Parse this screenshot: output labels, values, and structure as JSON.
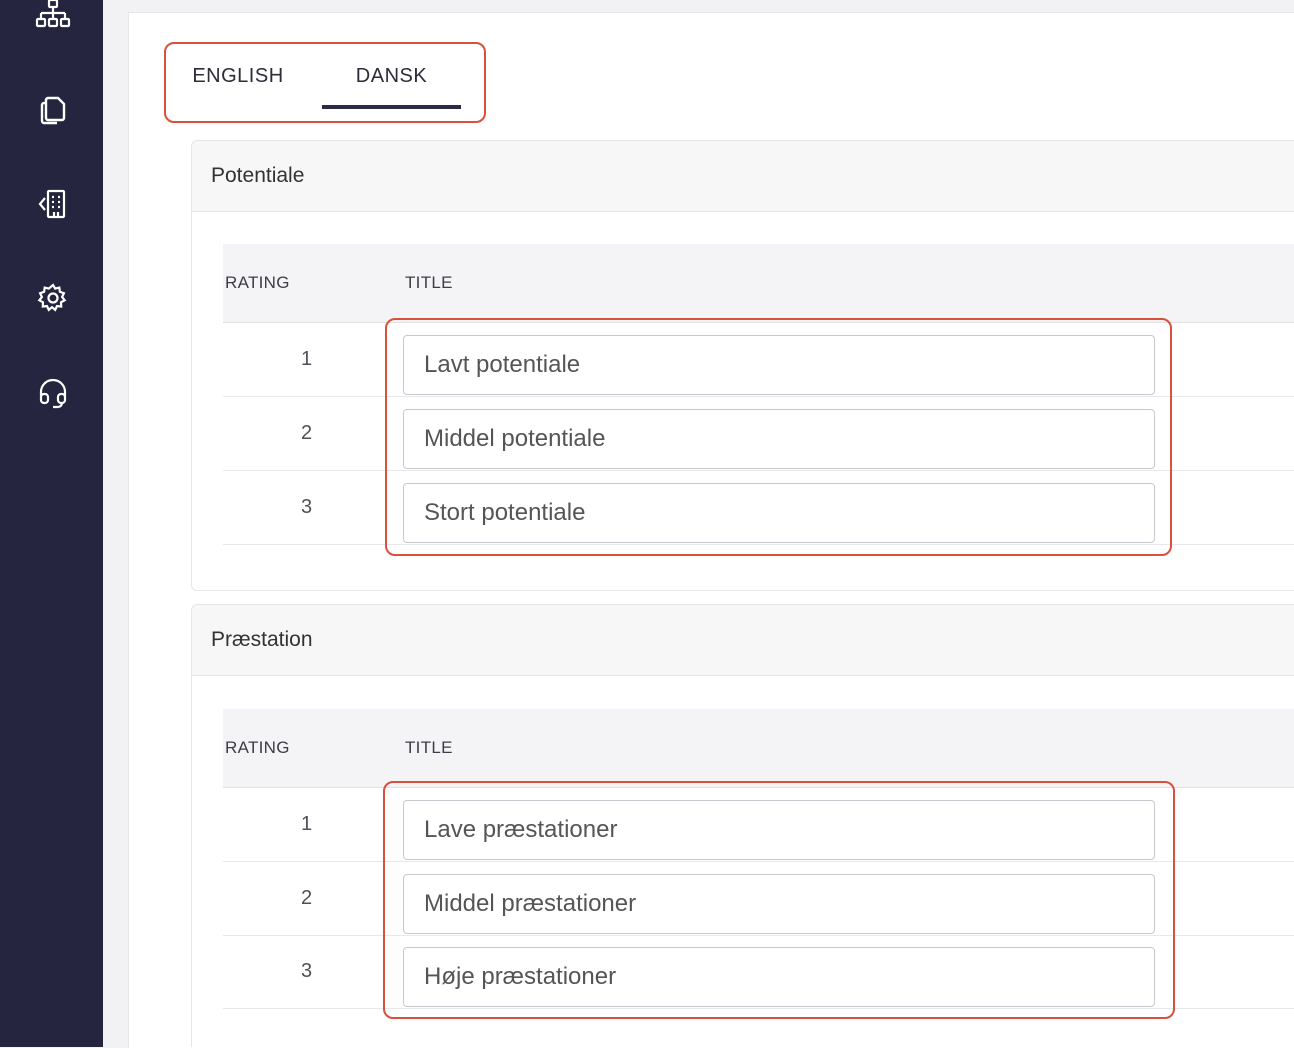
{
  "sidebar": {
    "items": [
      {
        "icon": "org-chart-icon"
      },
      {
        "icon": "documents-icon"
      },
      {
        "icon": "building-icon"
      },
      {
        "icon": "gear-icon"
      },
      {
        "icon": "headset-icon"
      }
    ]
  },
  "tabs": [
    {
      "label": "ENGLISH",
      "active": false
    },
    {
      "label": "DANSK",
      "active": true
    }
  ],
  "sections": [
    {
      "title": "Potentiale",
      "columns": {
        "rating": "RATING",
        "title": "TITLE"
      },
      "rows": [
        {
          "rating": "1",
          "title": "Lavt potentiale"
        },
        {
          "rating": "2",
          "title": "Middel potentiale"
        },
        {
          "rating": "3",
          "title": "Stort potentiale"
        }
      ]
    },
    {
      "title": "Præstation",
      "columns": {
        "rating": "RATING",
        "title": "TITLE"
      },
      "rows": [
        {
          "rating": "1",
          "title": "Lave præstationer"
        },
        {
          "rating": "2",
          "title": "Middel præstationer"
        },
        {
          "rating": "3",
          "title": "Høje præstationer"
        }
      ]
    }
  ],
  "colors": {
    "sidebar": "#25253f",
    "highlight": "#d9503d",
    "tab_underline": "#2b2b45"
  }
}
